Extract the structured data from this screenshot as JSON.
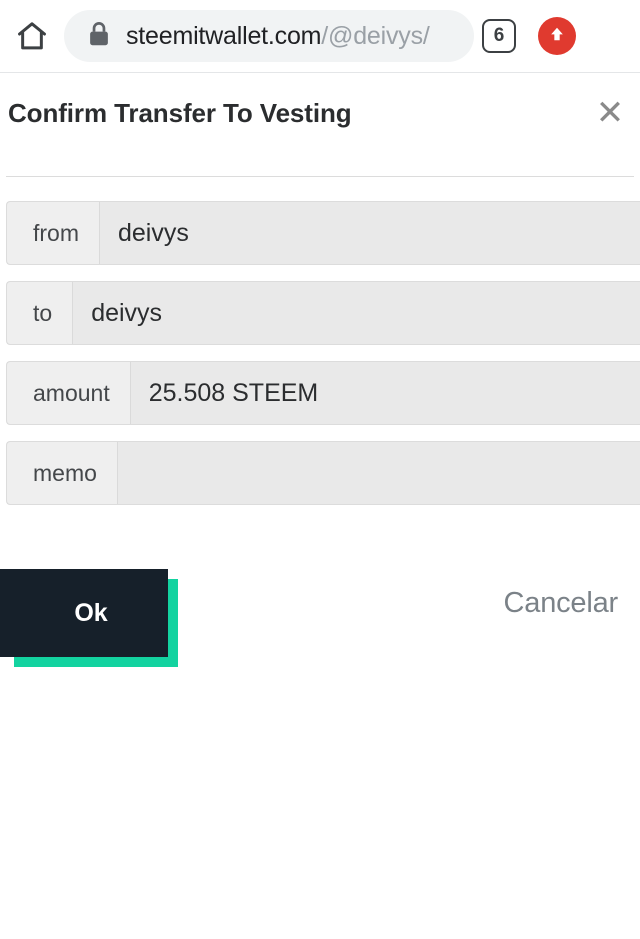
{
  "browser": {
    "home_icon": "home-icon",
    "lock_icon": "lock-icon",
    "url_domain": "steemitwallet.com",
    "url_path": "/@deivys/",
    "tab_count": "6",
    "update_icon": "up-arrow-icon"
  },
  "dialog": {
    "title": "Confirm Transfer To Vesting",
    "close_label": "✕",
    "fields": [
      {
        "label": "from",
        "value": "deivys"
      },
      {
        "label": "to",
        "value": "deivys"
      },
      {
        "label": "amount",
        "value": "25.508 STEEM"
      },
      {
        "label": "memo",
        "value": ""
      }
    ],
    "ok_label": "Ok",
    "cancel_label": "Cancelar"
  },
  "colors": {
    "accent_teal": "#13d3a0",
    "button_dark": "#16202a",
    "update_red": "#e03a2f",
    "field_bg": "#e9e9e9",
    "label_bg": "#efefef",
    "cancel_text": "#7b8288"
  }
}
